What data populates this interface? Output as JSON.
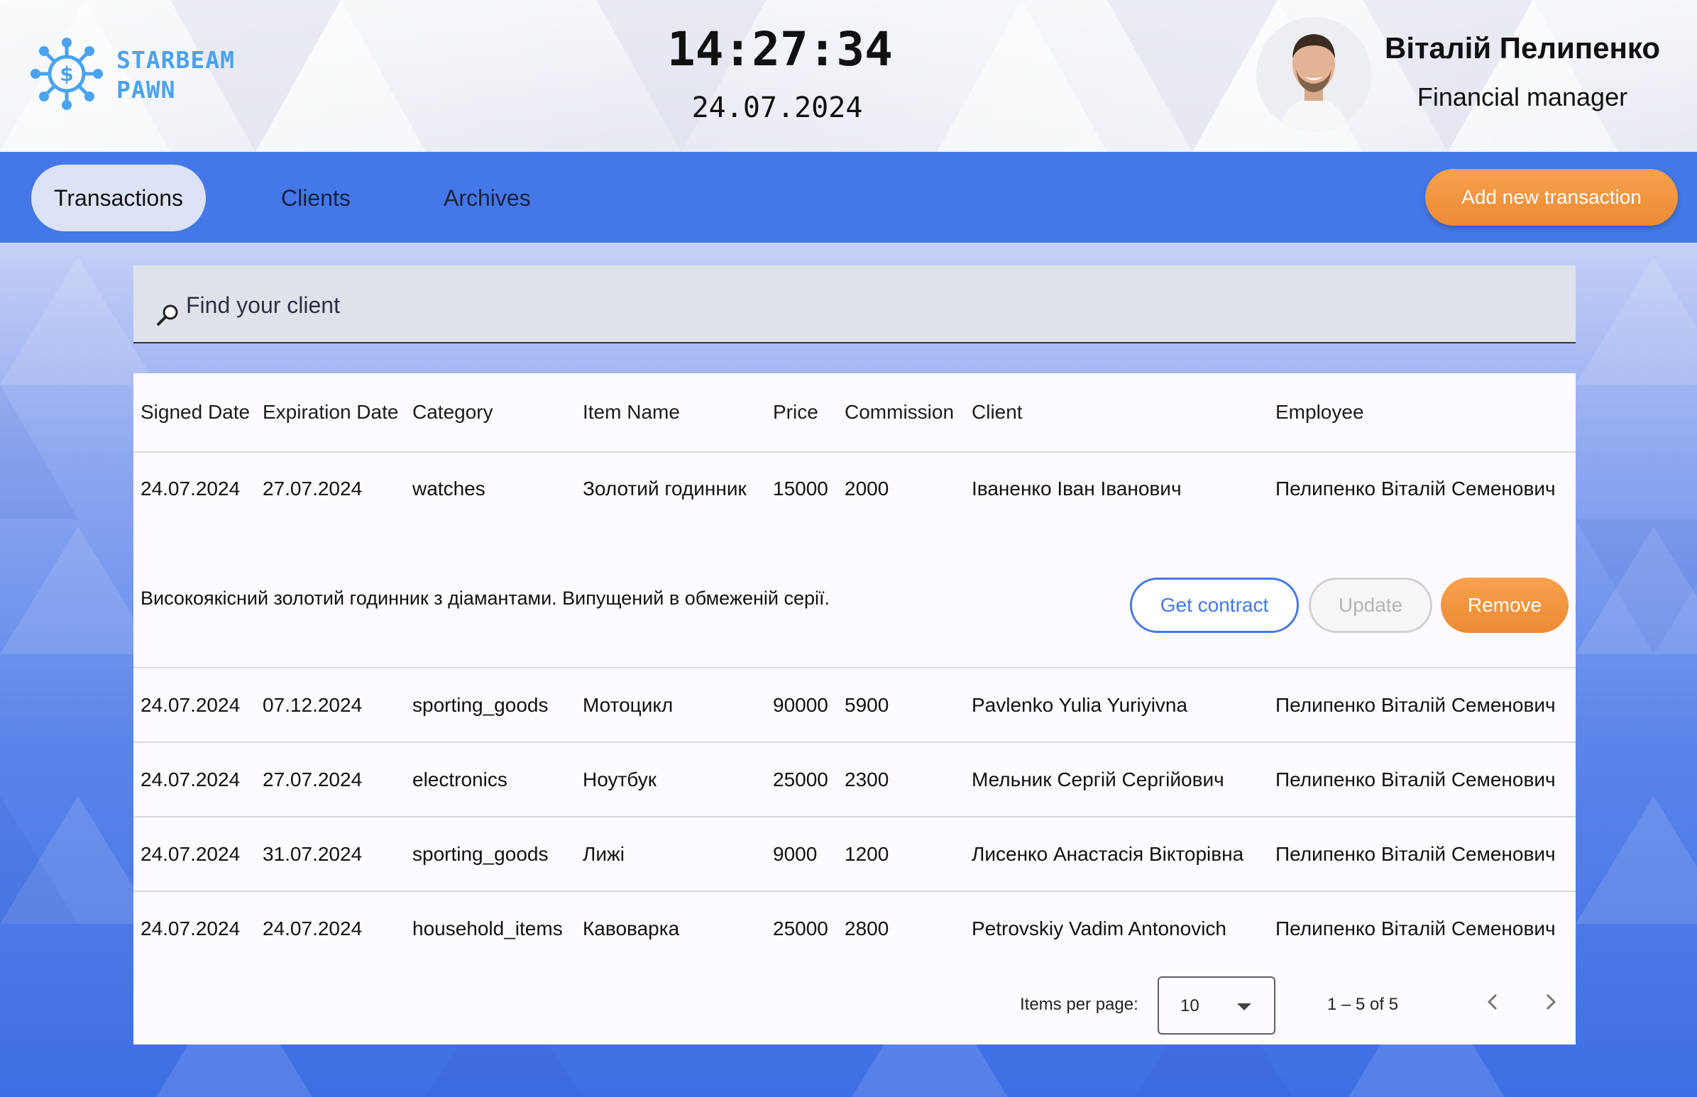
{
  "brand": {
    "line1": "STARBEAM",
    "line2": "PAWN",
    "color": "#4aa3ee"
  },
  "clock": {
    "time": "14:27:34",
    "date": "24.07.2024"
  },
  "user": {
    "name": "Віталій Пелипенко",
    "role": "Financial manager"
  },
  "nav": {
    "tabs": [
      {
        "label": "Transactions",
        "active": true
      },
      {
        "label": "Clients",
        "active": false
      },
      {
        "label": "Archives",
        "active": false
      }
    ],
    "add_button": "Add new transaction"
  },
  "search": {
    "placeholder": "Find your client"
  },
  "table": {
    "headers": [
      "Signed Date",
      "Expiration Date",
      "Category",
      "Item Name",
      "Price",
      "Commission",
      "Client",
      "Employee"
    ],
    "rows": [
      [
        "24.07.2024",
        "27.07.2024",
        "watches",
        "Золотий годинник",
        "15000",
        "2000",
        "Іваненко Іван Іванович",
        "Пелипенко Віталій Семенович"
      ],
      [
        "24.07.2024",
        "07.12.2024",
        "sporting_goods",
        "Мотоцикл",
        "90000",
        "5900",
        "Pavlenko Yulia Yuriyivna",
        "Пелипенко Віталій Семенович"
      ],
      [
        "24.07.2024",
        "27.07.2024",
        "electronics",
        "Ноутбук",
        "25000",
        "2300",
        "Мельник Сергій Сергійович",
        "Пелипенко Віталій Семенович"
      ],
      [
        "24.07.2024",
        "31.07.2024",
        "sporting_goods",
        "Лижі",
        "9000",
        "1200",
        "Лисенко Анастасія Вікторівна",
        "Пелипенко Віталій Семенович"
      ],
      [
        "24.07.2024",
        "24.07.2024",
        "household_items",
        "Кавоварка",
        "25000",
        "2800",
        "Petrovskiy Vadim Antonovich",
        "Пелипенко Віталій Семенович"
      ]
    ],
    "expanded": {
      "description": "Високоякісний золотий годинник з діамантами. Випущений в обмеженій серії.",
      "get_contract": "Get contract",
      "update": "Update",
      "remove": "Remove"
    }
  },
  "paginator": {
    "label": "Items per page:",
    "page_size": "10",
    "range": "1 – 5 of 5"
  },
  "colors": {
    "nav": "#4478e8",
    "accent_orange": "#ed8a35",
    "card": "#fdfbff"
  }
}
